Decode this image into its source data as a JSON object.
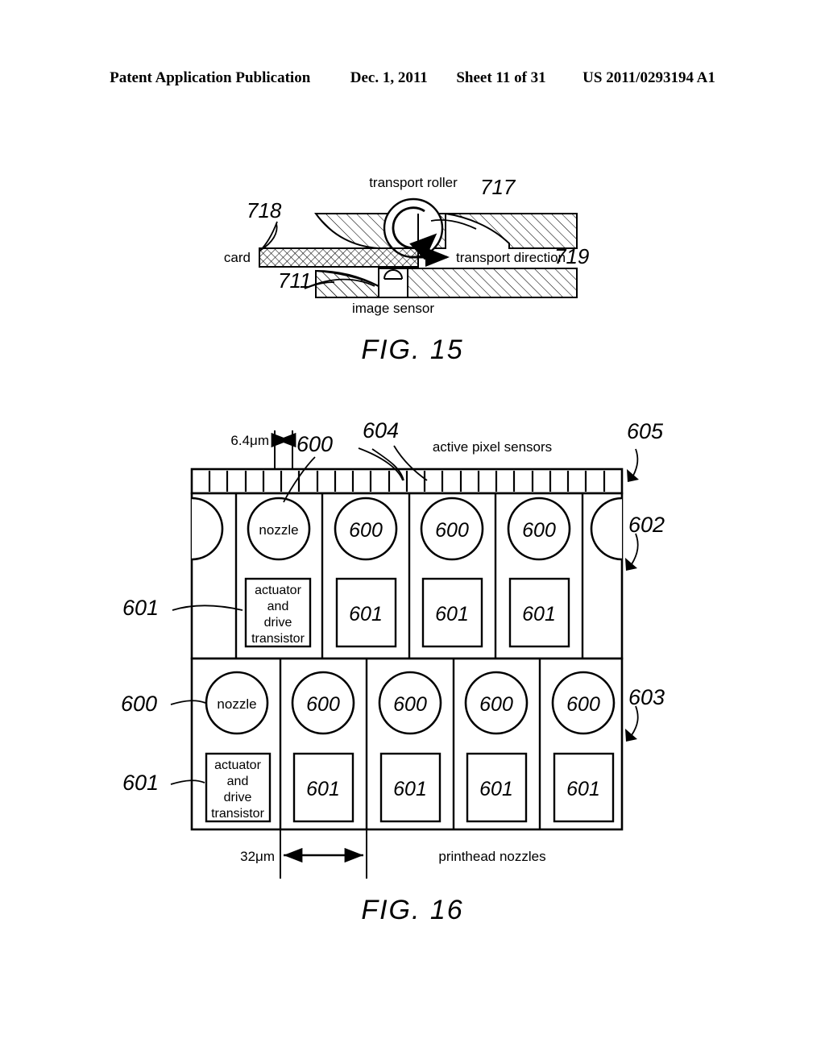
{
  "header": {
    "publication": "Patent Application Publication",
    "date": "Dec. 1, 2011",
    "sheet": "Sheet 11 of 31",
    "number": "US 2011/0293194 A1"
  },
  "fig15": {
    "caption": "FIG. 15",
    "labels": {
      "transport_roller": "transport roller",
      "card": "card",
      "transport_direction": "transport direction",
      "image_sensor": "image sensor"
    },
    "refs": {
      "roller": "717",
      "card": "718",
      "direction": "719",
      "sensor": "711"
    }
  },
  "fig16": {
    "caption": "FIG. 16",
    "labels": {
      "active_pixel_sensors": "active pixel sensors",
      "printhead_nozzles": "printhead nozzles",
      "pitch_small": "6.4μm",
      "pitch_large": "32μm",
      "nozzle": "nozzle",
      "actuator_line1": "actuator",
      "actuator_line2": "and",
      "actuator_line3": "drive",
      "actuator_line4": "transistor"
    },
    "refs": {
      "nozzle": "600",
      "actuator": "601",
      "row_upper": "602",
      "row_lower": "603",
      "sensor_cell": "604",
      "sensor_strip": "605"
    },
    "upper_row": {
      "nozzle_labels": [
        "nozzle",
        "600",
        "600",
        "600"
      ],
      "actuator_labels": [
        "actuator-text",
        "601",
        "601",
        "601"
      ]
    },
    "lower_row": {
      "nozzle_labels": [
        "nozzle",
        "600",
        "600",
        "600",
        "600"
      ],
      "actuator_labels": [
        "actuator-text",
        "601",
        "601",
        "601",
        "601"
      ]
    },
    "sensor_cell_count": 24
  },
  "colors": {
    "ink": "#000000",
    "paper": "#ffffff"
  }
}
